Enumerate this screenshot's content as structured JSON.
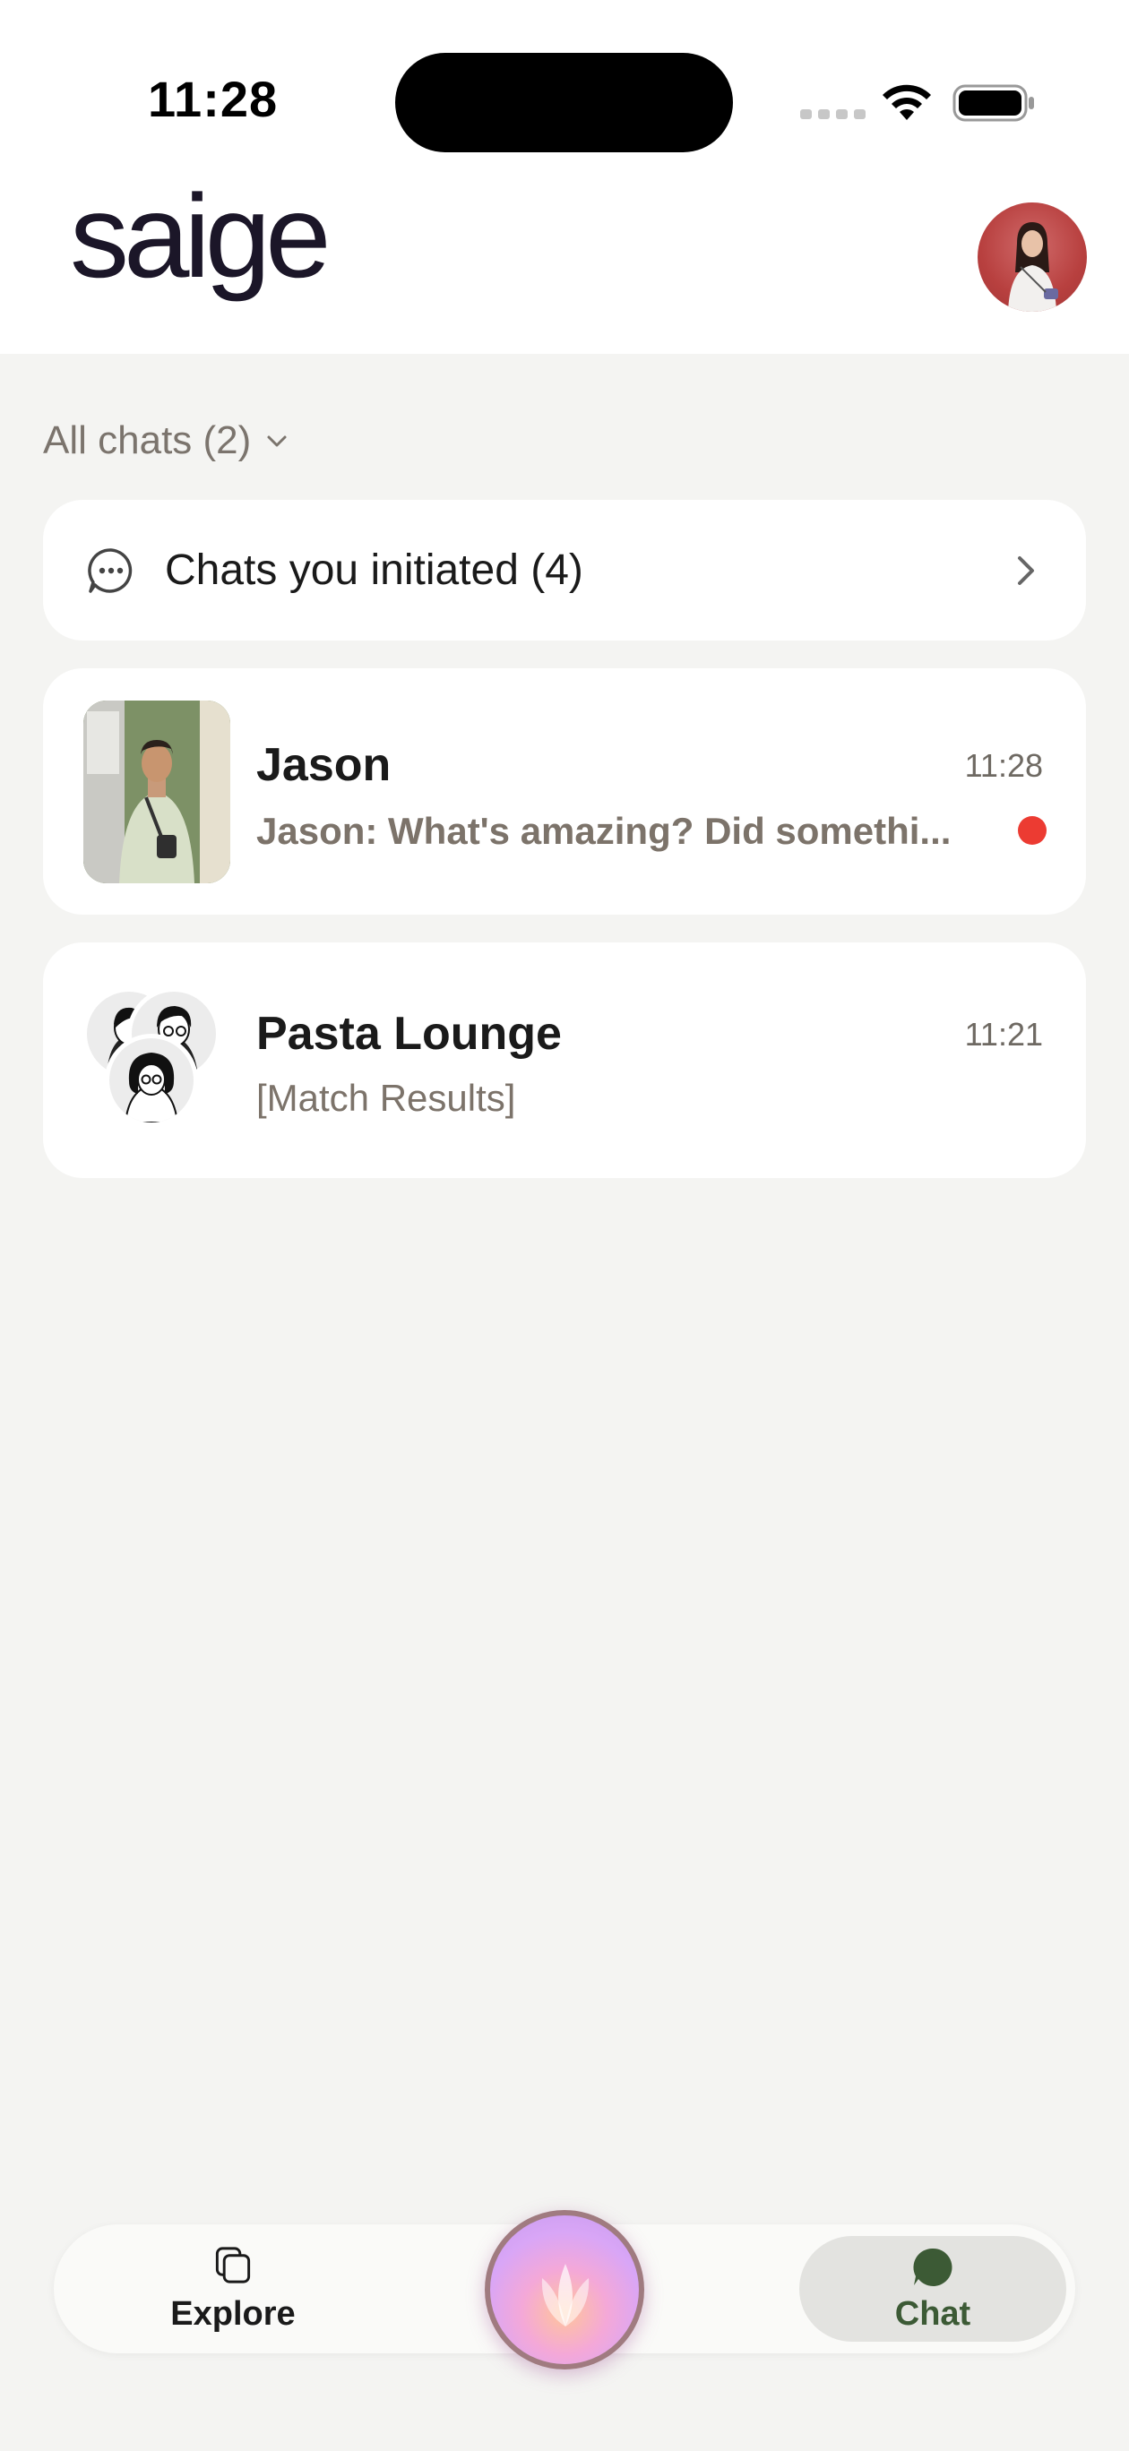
{
  "status_bar": {
    "time": "11:28"
  },
  "header": {
    "logo": "saige"
  },
  "filter": {
    "label": "All chats (2)"
  },
  "initiated": {
    "label": "Chats you initiated (4)"
  },
  "chats": [
    {
      "name": "Jason",
      "time": "11:28",
      "preview": "Jason: What's amazing? Did somethi...",
      "unread": true
    },
    {
      "name": "Pasta Lounge",
      "time": "11:21",
      "preview": "[Match Results]",
      "unread": false
    }
  ],
  "nav": {
    "explore_label": "Explore",
    "chat_label": "Chat"
  },
  "colors": {
    "background": "#f4f4f2",
    "accent_green": "#3c5a35",
    "unread_red": "#ec3b32",
    "logo": "#1b1628"
  }
}
